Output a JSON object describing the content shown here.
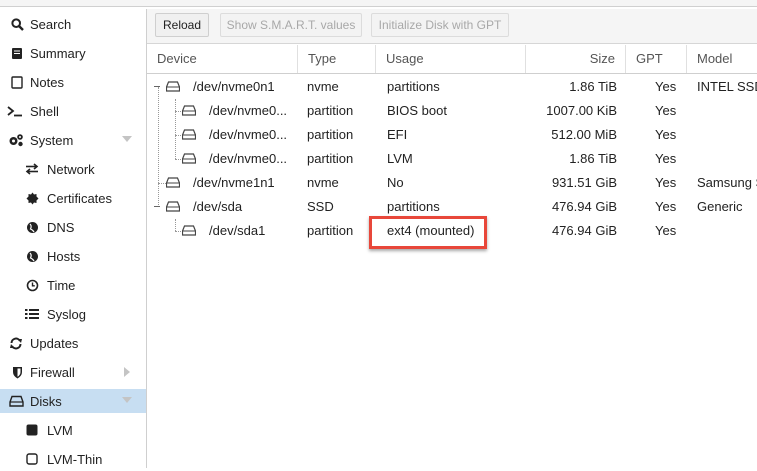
{
  "sidebar": {
    "items": [
      {
        "label": "Search",
        "icon": "search-icon"
      },
      {
        "label": "Summary",
        "icon": "book-icon"
      },
      {
        "label": "Notes",
        "icon": "notes-icon"
      },
      {
        "label": "Shell",
        "icon": "terminal-icon"
      },
      {
        "label": "System",
        "icon": "gears-icon"
      },
      {
        "label": "Network",
        "icon": "exchange-icon"
      },
      {
        "label": "Certificates",
        "icon": "certificate-icon"
      },
      {
        "label": "DNS",
        "icon": "globe-icon"
      },
      {
        "label": "Hosts",
        "icon": "globe-icon"
      },
      {
        "label": "Time",
        "icon": "clock-icon"
      },
      {
        "label": "Syslog",
        "icon": "list-icon"
      },
      {
        "label": "Updates",
        "icon": "refresh-icon"
      },
      {
        "label": "Firewall",
        "icon": "shield-icon"
      },
      {
        "label": "Disks",
        "icon": "hdd-icon"
      },
      {
        "label": "LVM",
        "icon": "square-icon"
      },
      {
        "label": "LVM-Thin",
        "icon": "square-outline-icon"
      }
    ],
    "selected": "Disks"
  },
  "toolbar": {
    "reload_label": "Reload",
    "smart_label": "Show S.M.A.R.T. values",
    "gpt_label": "Initialize Disk with GPT"
  },
  "grid": {
    "columns": [
      "Device",
      "Type",
      "Usage",
      "Size",
      "GPT",
      "Model"
    ],
    "rows": [
      {
        "device": "/dev/nvme0n1",
        "type": "nvme",
        "usage": "partitions",
        "size": "1.86 TiB",
        "gpt": "Yes",
        "model": "INTEL SSD"
      },
      {
        "device": "/dev/nvme0...",
        "type": "partition",
        "usage": "BIOS boot",
        "size": "1007.00 KiB",
        "gpt": "Yes",
        "model": ""
      },
      {
        "device": "/dev/nvme0...",
        "type": "partition",
        "usage": "EFI",
        "size": "512.00 MiB",
        "gpt": "Yes",
        "model": ""
      },
      {
        "device": "/dev/nvme0...",
        "type": "partition",
        "usage": "LVM",
        "size": "1.86 TiB",
        "gpt": "Yes",
        "model": ""
      },
      {
        "device": "/dev/nvme1n1",
        "type": "nvme",
        "usage": "No",
        "size": "931.51 GiB",
        "gpt": "Yes",
        "model": "Samsung S"
      },
      {
        "device": "/dev/sda",
        "type": "SSD",
        "usage": "partitions",
        "size": "476.94 GiB",
        "gpt": "Yes",
        "model": "Generic"
      },
      {
        "device": "/dev/sda1",
        "type": "partition",
        "usage": "ext4 (mounted)",
        "size": "476.94 GiB",
        "gpt": "Yes",
        "model": ""
      }
    ]
  },
  "colors": {
    "selected_nav": "#c7def2",
    "highlight_box": "#e8473a"
  }
}
